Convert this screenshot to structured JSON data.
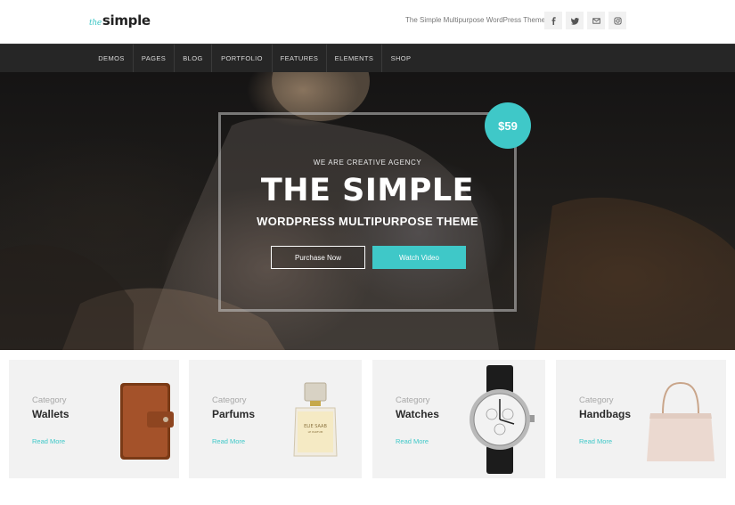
{
  "header": {
    "logo_prefix": "the",
    "logo_main": "simple",
    "tagline": "The Simple Multipurpose WordPress Theme",
    "social": [
      "facebook-icon",
      "twitter-icon",
      "email-icon",
      "instagram-icon"
    ]
  },
  "nav": {
    "items": [
      "DEMOS",
      "PAGES",
      "BLOG",
      "PORTFOLIO",
      "FEATURES",
      "ELEMENTS",
      "SHOP"
    ]
  },
  "hero": {
    "subtitle": "WE ARE CREATIVE AGENCY",
    "title": "THE SIMPLE",
    "tagline": "WORDPRESS MULTIPURPOSE THEME",
    "purchase_label": "Purchase Now",
    "watch_label": "Watch Video",
    "price": "$59"
  },
  "categories": [
    {
      "category_label": "Category",
      "name": "Wallets",
      "link": "Read More"
    },
    {
      "category_label": "Category",
      "name": "Parfums",
      "link": "Read More"
    },
    {
      "category_label": "Category",
      "name": "Watches",
      "link": "Read More"
    },
    {
      "category_label": "Category",
      "name": "Handbags",
      "link": "Read More"
    }
  ],
  "colors": {
    "accent": "#3fc8c8",
    "nav_bg": "#262626",
    "card_bg": "#f2f2f2"
  }
}
